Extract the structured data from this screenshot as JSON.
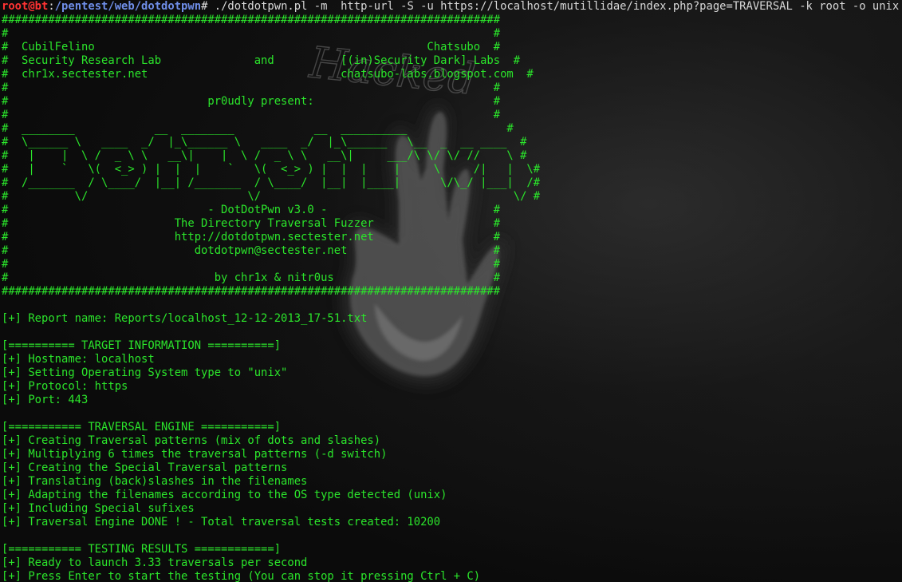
{
  "prompt": {
    "user_host": "root@bt",
    "separator": ":",
    "path": "/pentest/web/dotdotpwn",
    "symbol": "#",
    "command": " ./dotdotpwn.pl -m  http-url -S -u https://localhost/mutillidae/index.php?page=TRAVERSAL -k root -o unix"
  },
  "banner": [
    "###########################################################################",
    "#                                                                         #",
    "#  CubilFelino                                                  Chatsubo  #",
    "#  Security Research Lab              and          [(in)Security Dark] Labs  #",
    "#  chr1x.sectester.net                             chatsubo-labs.blogspot.com  #",
    "#                                                                         #",
    "#                              pr0udly present:                           #",
    "#                                                                         #",
    "#  ________            __  ________            __  __________               #",
    "#  \\______ \\   ____  _/  |_\\______ \\   ____  _/  |_\\______   \\__  _  __ ____  #",
    "#   |    |  \\ /  _ \\ \\   __\\|    |  \\ /  _ \\ \\   __\\|     ___/\\ \\/ \\/ //    \\ #",
    "#   |    `   \\(  <_> ) |  |  |    `   \\(  <_> ) |  |  |    |     \\     /|   |  \\#",
    "#  /_______  / \\____/  |__| /_______  / \\____/  |__|  |____|      \\/\\_/ |___|  /#",
    "#          \\/                        \\/                                      \\/ #",
    "#                              - DotDotPwn v3.0 -                         #",
    "#                         The Directory Traversal Fuzzer                  #",
    "#                         http://dotdotpwn.sectester.net                  #",
    "#                            dotdotpwn@sectester.net                      #",
    "#                                                                         #",
    "#                               by chr1x & nitr0us                        #",
    "###########################################################################"
  ],
  "output": [
    "",
    "[+] Report name: Reports/localhost_12-12-2013_17-51.txt",
    "",
    "[========== TARGET INFORMATION ==========]",
    "[+] Hostname: localhost",
    "[+] Setting Operating System type to \"unix\"",
    "[+] Protocol: https",
    "[+] Port: 443",
    "",
    "[=========== TRAVERSAL ENGINE ===========]",
    "[+] Creating Traversal patterns (mix of dots and slashes)",
    "[+] Multiplying 6 times the traversal patterns (-d switch)",
    "[+] Creating the Special Traversal patterns",
    "[+] Translating (back)slashes in the filenames",
    "[+] Adapting the filenames according to the OS type detected (unix)",
    "[+] Including Special sufixes",
    "[+] Traversal Engine DONE ! - Total traversal tests created: 10200",
    "",
    "[=========== TESTING RESULTS ============]",
    "[+] Ready to launch 3.33 traversals per second",
    "[+] Press Enter to start the testing (You can stop it pressing Ctrl + C)"
  ],
  "wallpaper": {
    "text": "Hacked",
    "icon": "handprint-icon"
  }
}
